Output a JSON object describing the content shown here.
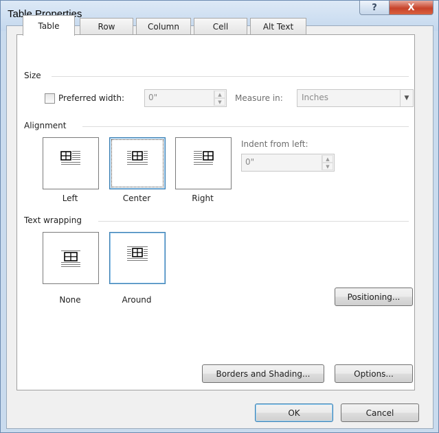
{
  "window": {
    "title": "Table Properties",
    "help_glyph": "?",
    "close_glyph": "X"
  },
  "tabs": [
    {
      "label": "Table",
      "active": true
    },
    {
      "label": "Row",
      "active": false
    },
    {
      "label": "Column",
      "active": false
    },
    {
      "label": "Cell",
      "active": false
    },
    {
      "label": "Alt Text",
      "active": false
    }
  ],
  "size": {
    "group_label": "Size",
    "preferred_width_label": "Preferred width:",
    "preferred_width_checked": false,
    "preferred_width_value": "0\"",
    "measure_in_label": "Measure in:",
    "measure_in_value": "Inches"
  },
  "alignment": {
    "group_label": "Alignment",
    "options": [
      {
        "label": "Left",
        "selected": false
      },
      {
        "label": "Center",
        "selected": true
      },
      {
        "label": "Right",
        "selected": false
      }
    ],
    "indent_label": "Indent from left:",
    "indent_value": "0\""
  },
  "wrapping": {
    "group_label": "Text wrapping",
    "options": [
      {
        "label": "None",
        "selected": false
      },
      {
        "label": "Around",
        "selected": true
      }
    ],
    "positioning_label": "Positioning..."
  },
  "buttons": {
    "borders_label": "Borders and Shading...",
    "options_label": "Options...",
    "ok_label": "OK",
    "cancel_label": "Cancel"
  },
  "colors": {
    "selected_border": "#3c7fb1",
    "close_red": "#c7432b",
    "panel_bg": "#ffffff"
  }
}
